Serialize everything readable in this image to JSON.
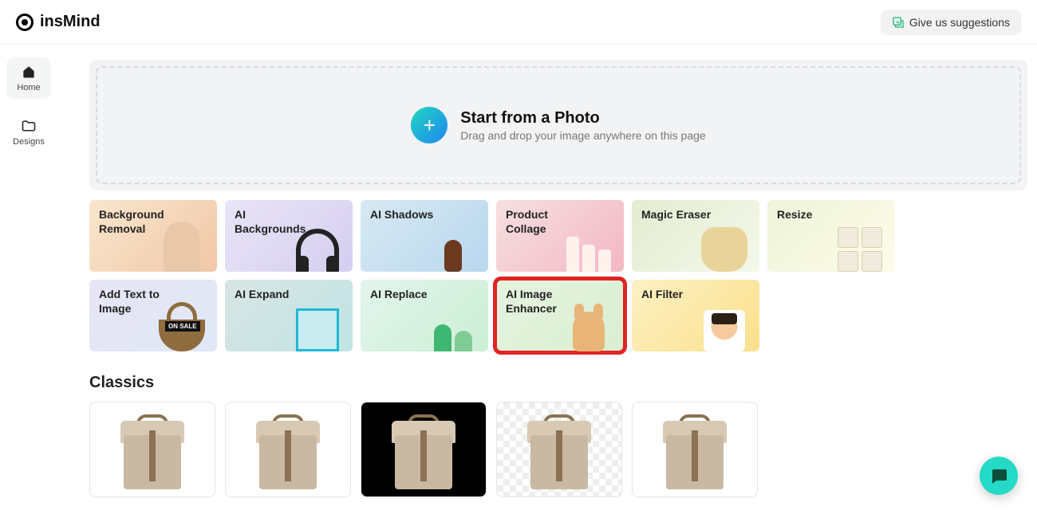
{
  "brand": {
    "name": "insMind"
  },
  "header": {
    "suggestions_label": "Give us suggestions"
  },
  "sidebar": {
    "items": [
      {
        "label": "Home",
        "active": true
      },
      {
        "label": "Designs",
        "active": false
      }
    ]
  },
  "upload": {
    "title": "Start from a Photo",
    "subtitle": "Drag and drop your image anywhere on this page"
  },
  "tools": [
    {
      "label": "Background Removal"
    },
    {
      "label": "AI Backgrounds"
    },
    {
      "label": "AI Shadows"
    },
    {
      "label": "Product Collage"
    },
    {
      "label": "Magic Eraser"
    },
    {
      "label": "Resize"
    },
    {
      "label": "Add Text to Image",
      "badge": "ON SALE"
    },
    {
      "label": "AI Expand"
    },
    {
      "label": "AI Replace"
    },
    {
      "label": "AI Image Enhancer",
      "highlighted": true
    },
    {
      "label": "AI Filter"
    }
  ],
  "classics": {
    "title": "Classics"
  }
}
